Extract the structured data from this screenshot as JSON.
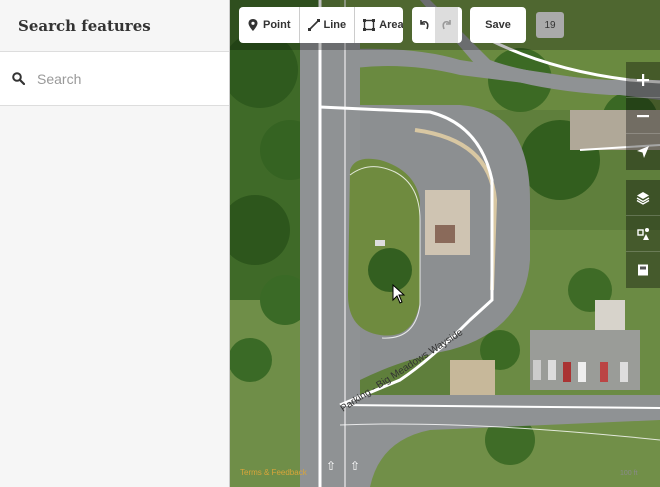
{
  "sidebar": {
    "title": "Search features",
    "search_placeholder": "Search"
  },
  "toolbar": {
    "point_label": "Point",
    "line_label": "Line",
    "area_label": "Area",
    "save_label": "Save",
    "edit_count": "19"
  },
  "map": {
    "road_label": "Parking - Big Meadows Wayside",
    "attribution": "Terms & Feedback",
    "scale": "100 ft"
  },
  "colors": {
    "accent": "#7092ff",
    "sidebar_bg": "#f6f6f6",
    "road": "#ffffff"
  }
}
